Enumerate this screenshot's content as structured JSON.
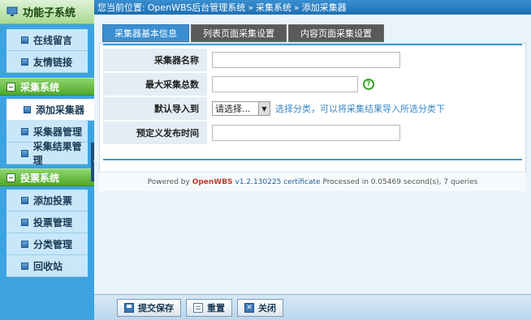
{
  "sidebar": {
    "title": "功能子系统",
    "top_items": [
      {
        "label": "在线留言"
      },
      {
        "label": "友情链接"
      }
    ],
    "sections": [
      {
        "title": "采集系统",
        "items": [
          {
            "label": "添加采集器",
            "active": true
          },
          {
            "label": "采集器管理"
          },
          {
            "label": "采集结果管理"
          }
        ]
      },
      {
        "title": "投票系统",
        "items": [
          {
            "label": "添加投票"
          },
          {
            "label": "投票管理"
          },
          {
            "label": "分类管理"
          },
          {
            "label": "回收站"
          }
        ]
      }
    ]
  },
  "breadcrumb": {
    "prefix": "您当前位置:",
    "crumbs": [
      "OpenWBS后台管理系统",
      "»",
      "采集系统",
      "»",
      "添加采集器"
    ]
  },
  "tabs": [
    {
      "label": "采集器基本信息",
      "active": true
    },
    {
      "label": "列表页面采集设置"
    },
    {
      "label": "内容页面采集设置"
    }
  ],
  "form": {
    "name_label": "采集器名称",
    "name_value": "",
    "max_label": "最大采集总数",
    "max_value": "",
    "max_help": "?",
    "import_label": "默认导入到",
    "import_selected": "请选择...",
    "import_hint": "选择分类，可以将采集结果导入所选分类下",
    "time_label": "预定义发布时间",
    "time_value": ""
  },
  "footer": {
    "powered": "Powered by",
    "brand": "OpenWBS",
    "version": "v1.2.130225 certificate",
    "processed": "Processed in 0.05469 second(s), 7 queries"
  },
  "buttons": {
    "save": "提交保存",
    "reset": "重置",
    "close": "关闭"
  }
}
